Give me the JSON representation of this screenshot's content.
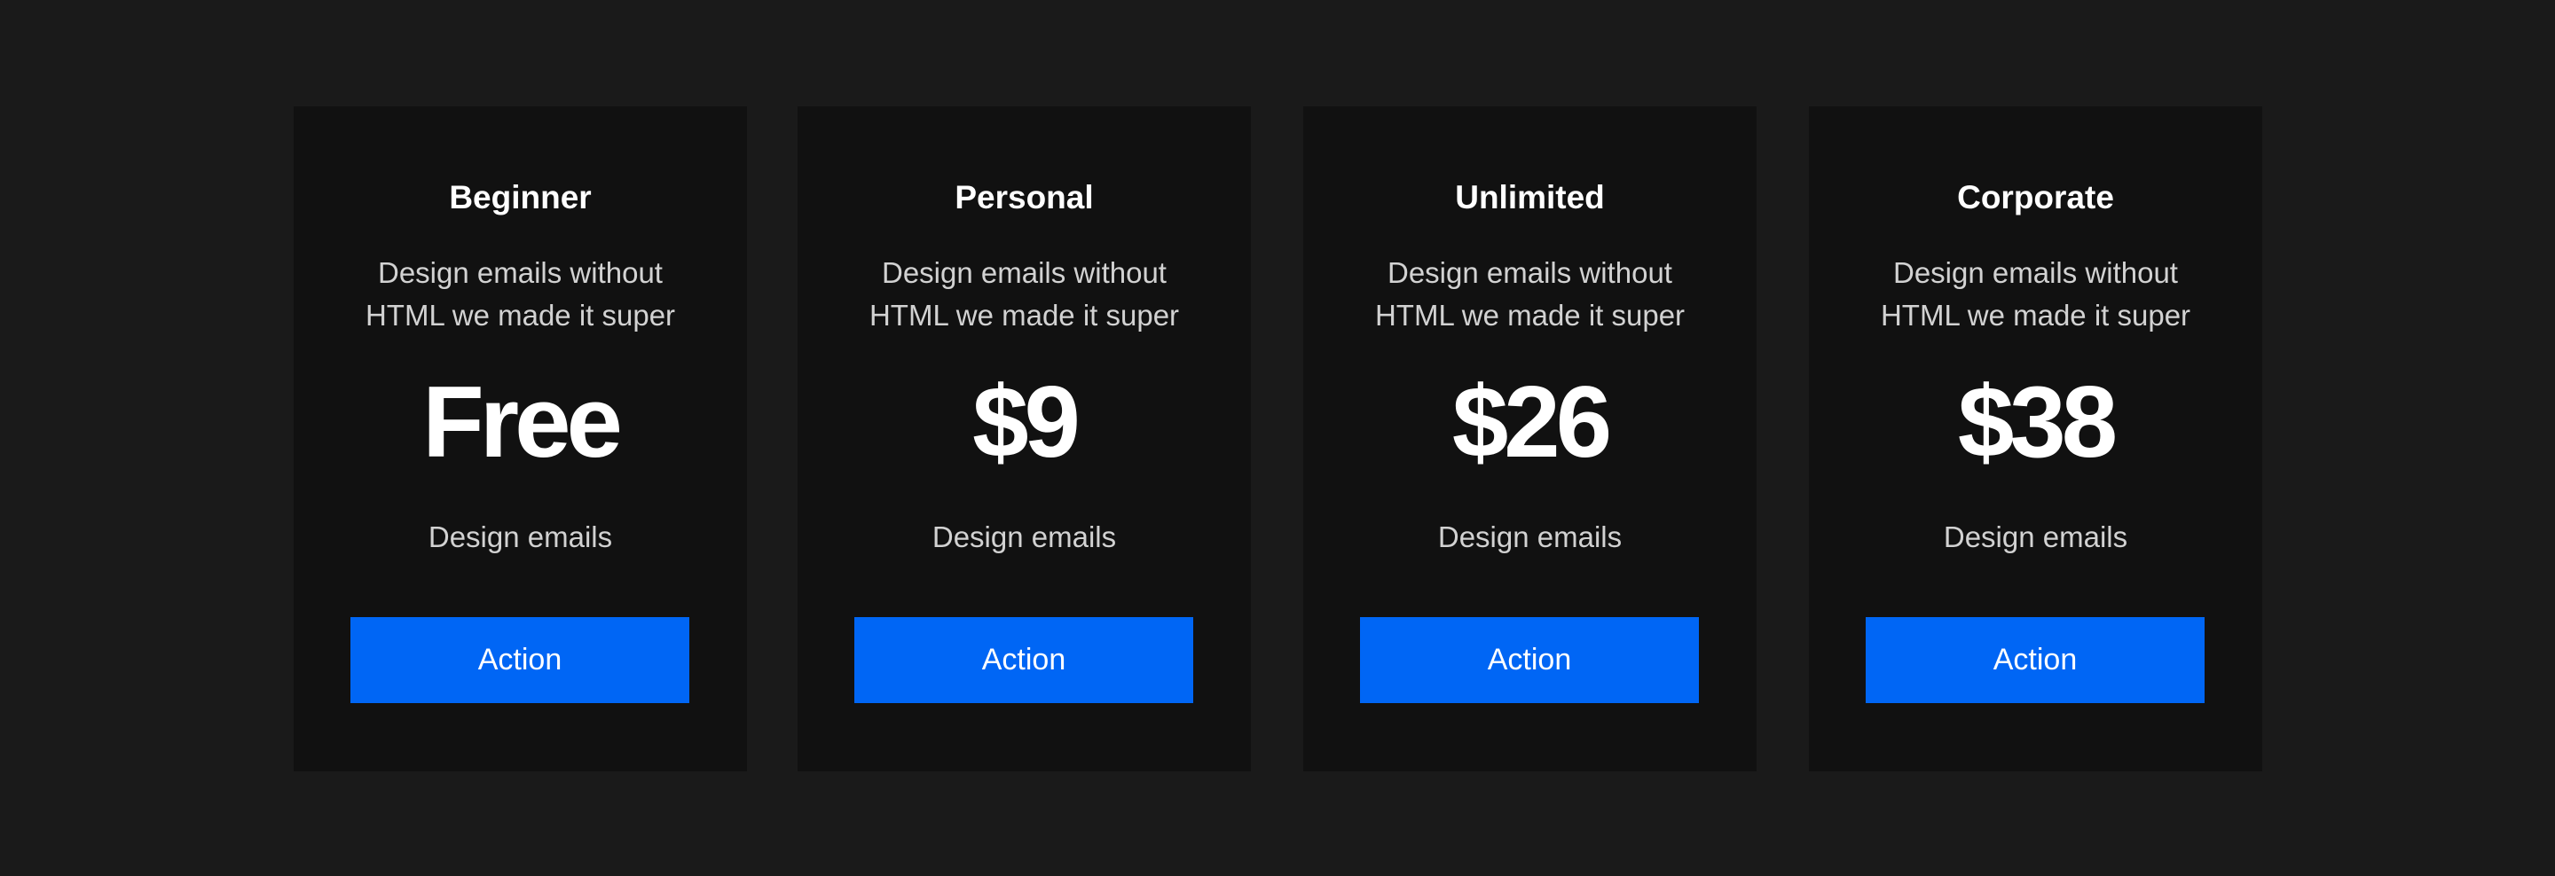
{
  "accent_color": "#0066f5",
  "plans": [
    {
      "title": "Beginner",
      "description_lines": [
        "Design emails without",
        "HTML we made it super"
      ],
      "price": "Free",
      "feature": "Design emails",
      "button_label": "Action"
    },
    {
      "title": "Personal",
      "description_lines": [
        "Design emails without",
        "HTML we made it super"
      ],
      "price": "$9",
      "feature": "Design emails",
      "button_label": "Action"
    },
    {
      "title": "Unlimited",
      "description_lines": [
        "Design emails without",
        "HTML we made it super"
      ],
      "price": "$26",
      "feature": "Design emails",
      "button_label": "Action"
    },
    {
      "title": "Corporate",
      "description_lines": [
        "Design emails without",
        "HTML we made it super"
      ],
      "price": "$38",
      "feature": "Design emails",
      "button_label": "Action"
    }
  ]
}
